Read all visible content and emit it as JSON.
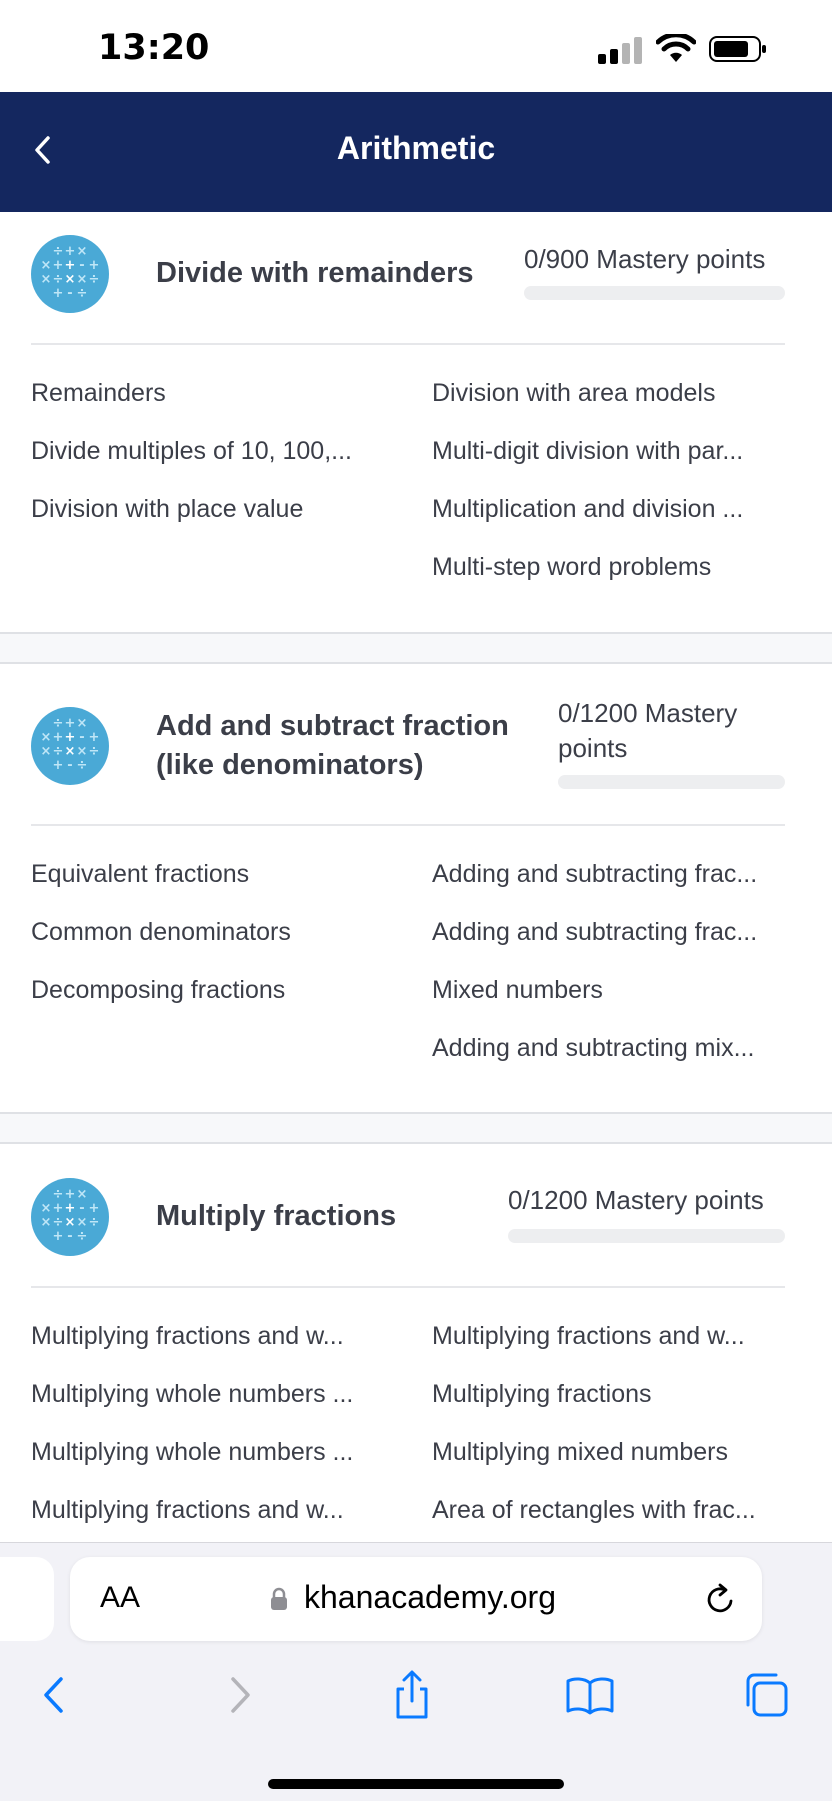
{
  "status_bar": {
    "time": "13:20"
  },
  "header": {
    "title": "Arithmetic"
  },
  "units": [
    {
      "title": "Divide with remainders",
      "mastery": "0/900 Mastery points",
      "progress": 0,
      "lessons_left": [
        "Remainders",
        "Divide multiples of 10, 100,...",
        "Division with place value"
      ],
      "lessons_right": [
        "Division with area models",
        "Multi-digit division with par...",
        "Multiplication and division ...",
        "Multi-step word problems"
      ]
    },
    {
      "title": "Add and subtract fraction (like denominators)",
      "title_line1": "Add and subtract fraction",
      "title_line2": "(like denominators)",
      "mastery": "0/1200 Mastery points",
      "mastery_line1": "0/1200 Mastery",
      "mastery_line2": "points",
      "progress": 0,
      "lessons_left": [
        "Equivalent fractions",
        "Common denominators",
        "Decomposing fractions"
      ],
      "lessons_right": [
        "Adding and subtracting frac...",
        "Adding and subtracting frac...",
        "Mixed numbers",
        "Adding and subtracting mix..."
      ]
    },
    {
      "title": "Multiply fractions",
      "mastery": "0/1200 Mastery points",
      "progress": 0,
      "lessons_left": [
        "Multiplying fractions and w...",
        "Multiplying whole numbers ...",
        "Multiplying whole numbers ...",
        "Multiplying fractions and w..."
      ],
      "lessons_right": [
        "Multiplying fractions and w...",
        "Multiplying fractions",
        "Multiplying mixed numbers",
        "Area of rectangles with frac..."
      ]
    }
  ],
  "browser": {
    "text_size_label": "AA",
    "host": "khanacademy.org"
  },
  "icons": {
    "back": "chevron-left-icon",
    "unit": "math-symbols-icon",
    "lock": "lock-icon",
    "reload": "reload-icon",
    "nav_back": "chevron-left-icon",
    "nav_forward": "chevron-right-icon",
    "share": "share-icon",
    "bookmarks": "book-icon",
    "tabs": "tabs-icon"
  },
  "colors": {
    "header_bg": "#14275f",
    "unit_icon": "#4aa9d6",
    "ios_blue": "#0a7aff"
  }
}
